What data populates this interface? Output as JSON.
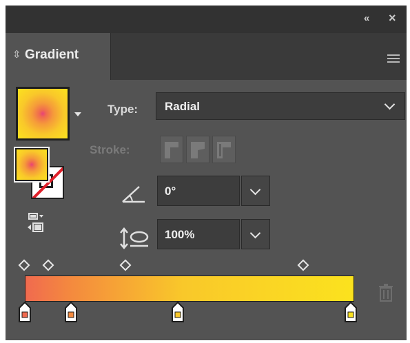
{
  "titlebar": {
    "collapse_icon": "«",
    "close_icon": "×"
  },
  "tab": {
    "arrows_icon": "⇳",
    "title": "Gradient"
  },
  "type": {
    "label": "Type:",
    "value": "Radial"
  },
  "stroke": {
    "label": "Stroke:"
  },
  "angle": {
    "value": "0°"
  },
  "aspect": {
    "value": "100%"
  },
  "colors": {
    "panel_bg": "#535353",
    "titlebar_bg": "#323232",
    "field_bg": "#3d3d3d",
    "gradient_start": "#f06a4f",
    "gradient_mid": "#f9c82a",
    "gradient_end": "#fbe21e",
    "no_stroke_red": "#e0202a"
  },
  "gradient": {
    "type": "radial",
    "stops": [
      {
        "color": "#f06a4f",
        "position": 0
      },
      {
        "color": "#f48a3e",
        "position": 14
      },
      {
        "color": "#f9c82a",
        "position": 48
      },
      {
        "color": "#fbe21e",
        "position": 100
      }
    ],
    "midpoints": [
      0,
      7,
      31,
      85
    ]
  },
  "icons": [
    "collapse-icon",
    "close-icon",
    "panel-arrows-icon",
    "panel-menu-icon",
    "swatch-menu-icon",
    "swap-fill-stroke-icon",
    "angle-icon",
    "aspect-ratio-icon",
    "trash-icon"
  ]
}
